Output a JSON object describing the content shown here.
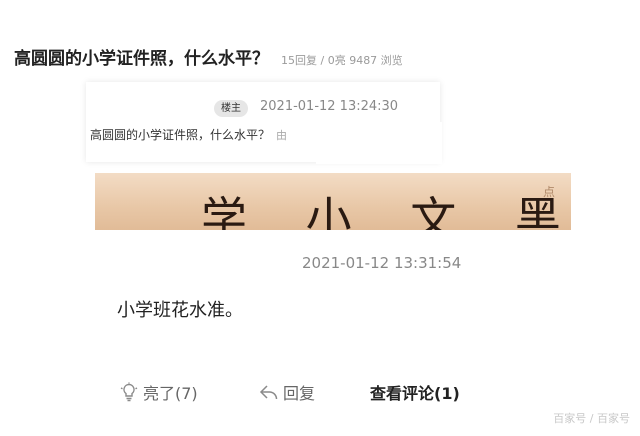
{
  "header": {
    "title": "高圆圆的小学证件照，什么水平？",
    "meta": "15回复 / 0亮 9487 浏览"
  },
  "post": {
    "badge": "楼主",
    "time": "2021-01-12 13:24:30",
    "text": "高圆圆的小学证件照，什么水平？",
    "by": "由",
    "photo_text": "学 小 文 黑 图",
    "photo_stamp": "点"
  },
  "reply": {
    "time": "2021-01-12 13:31:54",
    "text": "小学班花水准。"
  },
  "actions": {
    "like": "亮了(7)",
    "reply": "回复",
    "view_comments": "查看评论(1)"
  },
  "watermark": "百家号 / 百家号"
}
